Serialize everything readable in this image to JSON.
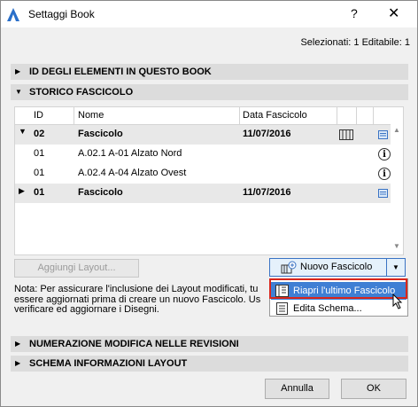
{
  "window": {
    "title": "Settaggi Book",
    "help": "?",
    "close": "✕"
  },
  "status": "Selezionati: 1 Editabile: 1",
  "sections": {
    "id_elementi": "ID DEGLI ELEMENTI IN QUESTO BOOK",
    "storico": "STORICO FASCICOLO",
    "numerazione": "NUMERAZIONE MODIFICA NELLE REVISIONI",
    "schema": "SCHEMA INFORMAZIONI LAYOUT"
  },
  "table": {
    "headers": {
      "id": "ID",
      "nome": "Nome",
      "data": "Data Fascicolo"
    },
    "rows": [
      {
        "id": "02",
        "nome": "Fascicolo",
        "data": "11/07/2016"
      },
      {
        "id": "01",
        "nome": "A.02.1 A-01 Alzato Nord",
        "data": ""
      },
      {
        "id": "01",
        "nome": "A.02.4 A-04 Alzato Ovest",
        "data": ""
      },
      {
        "id": "01",
        "nome": "Fascicolo",
        "data": "11/07/2016"
      }
    ]
  },
  "buttons": {
    "aggiungi": "Aggiungi Layout...",
    "nuovo": "Nuovo Fascicolo",
    "annulla": "Annulla",
    "ok": "OK"
  },
  "menu": {
    "riapri": "Riapri l'ultimo Fascicolo",
    "edita": "Edita Schema..."
  },
  "note": {
    "l1": "Nota: Per assicurare l'inclusione dei Layout modificati, tu",
    "l2": "essere aggiornati prima di creare un nuovo Fascicolo. Us",
    "l3": "verificare ed aggiornare i Disegni."
  },
  "icons": {
    "app": "archicad-logo-icon",
    "layout_book": "layout-book-icon",
    "info": "info-icon",
    "sheet": "sheet-icon",
    "new_issue": "new-issue-icon"
  },
  "colors": {
    "highlight": "#3f7fd4",
    "red_outline": "#d9261c",
    "link_blue": "#3a73c4"
  }
}
